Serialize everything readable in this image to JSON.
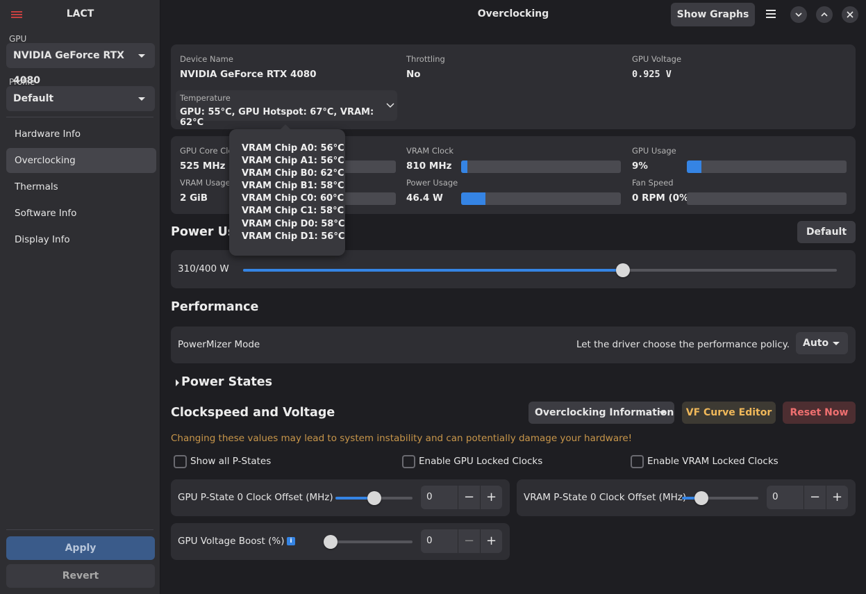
{
  "sidebar": {
    "app_title": "LACT",
    "gpu_label": "GPU",
    "gpu_selected": "NVIDIA GeForce RTX 4080",
    "profile_label": "Profile",
    "profile_selected": "Default",
    "nav": [
      {
        "label": "Hardware Info",
        "active": false
      },
      {
        "label": "Overclocking",
        "active": true
      },
      {
        "label": "Thermals",
        "active": false
      },
      {
        "label": "Software Info",
        "active": false
      },
      {
        "label": "Display Info",
        "active": false
      }
    ],
    "apply_label": "Apply",
    "revert_label": "Revert"
  },
  "header": {
    "title": "Overclocking",
    "show_graphs_label": "Show Graphs"
  },
  "info": {
    "device_name_label": "Device Name",
    "device_name": "NVIDIA GeForce RTX 4080",
    "throttling_label": "Throttling",
    "throttling": "No",
    "voltage_label": "GPU Voltage",
    "voltage": "0.925 V",
    "temperature_label": "Temperature",
    "temperature": "GPU: 55°C, GPU Hotspot: 67°C, VRAM: 62°C"
  },
  "stats": {
    "core_clock_label": "GPU Core Clock",
    "core_clock": "525 MHz",
    "core_clock_fraction": 0.3,
    "vram_clock_label": "VRAM Clock",
    "vram_clock": "810 MHz",
    "vram_clock_fraction": 0.04,
    "gpu_usage_label": "GPU Usage",
    "gpu_usage": "9%",
    "gpu_usage_fraction": 0.09,
    "vram_usage_label": "VRAM Usage:",
    "vram_usage": "2 GiB",
    "vram_usage_fraction": 0.12,
    "power_usage_label": "Power Usage",
    "power_usage": "46.4 W",
    "power_usage_fraction": 0.15,
    "fan_speed_label": "Fan Speed",
    "fan_speed": "0 RPM (0%)",
    "fan_speed_fraction": 0.0
  },
  "vram_popover": [
    "VRAM Chip A0: 56°C",
    "VRAM Chip A1: 56°C",
    "VRAM Chip B0: 62°C",
    "VRAM Chip B1: 58°C",
    "VRAM Chip C0: 60°C",
    "VRAM Chip C1: 58°C",
    "VRAM Chip D0: 58°C",
    "VRAM Chip D1: 56°C"
  ],
  "power": {
    "title": "Power Usa",
    "default_label": "Default",
    "value": "310/400 W",
    "fraction": 0.64
  },
  "performance": {
    "title": "Performance",
    "mode_label": "PowerMizer Mode",
    "description": "Let the driver choose the performance policy.",
    "mode_value": "Auto"
  },
  "power_states": {
    "title": "Power States"
  },
  "clocks": {
    "title": "Clockspeed and Voltage",
    "oc_info_label": "Overclocking Information",
    "vf_curve_label": "VF Curve Editor",
    "reset_label": "Reset Now",
    "warning": "Changing these values may lead to system instability and can potentially damage your hardware!",
    "show_all_pstates": "Show all P-States",
    "enable_gpu_locked": "Enable GPU Locked Clocks",
    "enable_vram_locked": "Enable VRAM Locked Clocks",
    "gpu_offset_label": "GPU P-State 0 Clock Offset (MHz)",
    "gpu_offset_value": "0",
    "gpu_offset_fraction": 0.5,
    "vram_offset_label": "VRAM P-State 0 Clock Offset (MHz)",
    "vram_offset_value": "0",
    "vram_offset_fraction": 0.25,
    "voltage_boost_label": "GPU Voltage Boost (%)",
    "voltage_boost_value": "0",
    "voltage_boost_fraction": 0.0
  },
  "colors": {
    "accent": "#3584e4",
    "warning_text": "#c8964a",
    "vf_curve_text": "#f0b85a",
    "reset_text": "#f07070",
    "reset_bg": "#4d2e31"
  }
}
